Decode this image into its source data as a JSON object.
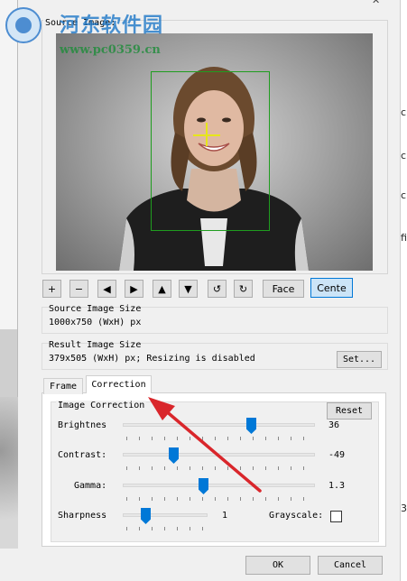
{
  "source_image": {
    "label": "Source Image:"
  },
  "watermark": {
    "title": "河东软件园",
    "url": "www.pc0359.cn"
  },
  "toolbar": {
    "plus": "+",
    "minus": "−",
    "left": "◀",
    "right": "▶",
    "up": "▲",
    "down": "▼",
    "rotate_ccw": "↺",
    "rotate_cw": "↻",
    "face_label": "Face",
    "center_label": "Cente"
  },
  "source_size": {
    "label": "Source Image Size",
    "value": "1000x750 (WxH) px"
  },
  "result_size": {
    "label": "Result Image Size",
    "value": "379x505 (WxH) px; Resizing is disabled",
    "set_label": "Set..."
  },
  "tabs": [
    {
      "label": "Frame"
    },
    {
      "label": "Correction"
    }
  ],
  "correction": {
    "group_label": "Image Correction",
    "reset_label": "Reset",
    "brightness": {
      "label": "Brightnes",
      "value": "36",
      "level": 36
    },
    "contrast": {
      "label": "Contrast:",
      "value": "-49",
      "level": -49
    },
    "gamma": {
      "label": "Gamma:",
      "value": "1.3",
      "level": 1.3
    },
    "sharpness": {
      "label": "Sharpness",
      "value": "1",
      "level": 1
    },
    "grayscale": {
      "label": "Grayscale:",
      "checked": false
    }
  },
  "footer": {
    "ok_label": "OK",
    "cancel_label": "Cancel"
  },
  "background_window": {
    "snippets": [
      "c",
      "c",
      "c",
      "fi",
      "3"
    ]
  },
  "colors": {
    "accent": "#0078d7",
    "face_box": "#1f9d1f",
    "crosshair": "#e6e61a",
    "arrow": "#d9262b"
  }
}
